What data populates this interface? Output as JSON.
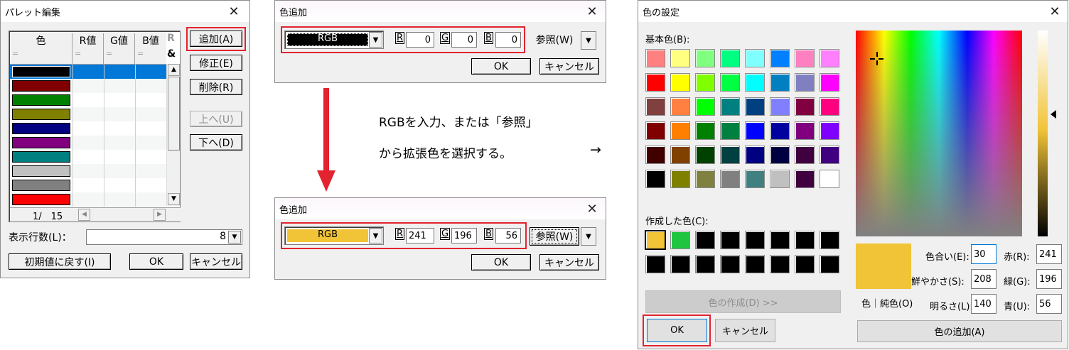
{
  "palette_edit": {
    "title": "パレット編集",
    "columns": [
      "色",
      "R値",
      "G値",
      "B値",
      "R",
      "&"
    ],
    "col_sub": "=",
    "swatches": [
      "#000000",
      "#800000",
      "#008000",
      "#808000",
      "#000080",
      "#800080",
      "#008080",
      "#c0c0c0",
      "#808080",
      "#ff0000"
    ],
    "counter": "1/　15",
    "buttons": {
      "add": "追加(A)",
      "modify": "修正(E)",
      "delete": "削除(R)",
      "up": "上へ(U)",
      "down": "下へ(D)"
    },
    "rows_label": "表示行数(L)：",
    "rows_value": "8",
    "reset": "初期値に戻す(I)",
    "ok": "OK",
    "cancel": "キャンセル"
  },
  "color_add_top": {
    "title": "色追加",
    "mode": "RGB",
    "swatch_color": "#000000",
    "r_label": "R",
    "r_value": "0",
    "g_label": "G",
    "g_value": "0",
    "b_label": "B",
    "b_value": "0",
    "ref": "参照(W)",
    "ok": "OK",
    "cancel": "キャンセル"
  },
  "color_add_bottom": {
    "title": "色追加",
    "mode": "RGB",
    "swatch_color": "#f1c438",
    "r_label": "R",
    "r_value": "241",
    "g_label": "G",
    "g_value": "196",
    "b_label": "B",
    "b_value": "56",
    "ref": "参照(W)",
    "ok": "OK",
    "cancel": "キャンセル"
  },
  "instruction": {
    "line1": "RGBを入力、または「参照」",
    "line2": "から拡張色を選択する。",
    "arrow": "→"
  },
  "color_settings": {
    "title": "色の設定",
    "basic_label": "基本色(B):",
    "basic_colors": [
      "#ff8080",
      "#ffff80",
      "#80ff80",
      "#00ff80",
      "#80ffff",
      "#0080ff",
      "#ff80c0",
      "#ff80ff",
      "#ff0000",
      "#ffff00",
      "#80ff00",
      "#00ff40",
      "#00ffff",
      "#0080c0",
      "#8080c0",
      "#ff00ff",
      "#804040",
      "#ff8040",
      "#00ff00",
      "#008080",
      "#004080",
      "#8080ff",
      "#800040",
      "#ff0080",
      "#800000",
      "#ff8000",
      "#008000",
      "#008040",
      "#0000ff",
      "#0000a0",
      "#800080",
      "#8000ff",
      "#400000",
      "#804000",
      "#004000",
      "#004040",
      "#000080",
      "#000040",
      "#400040",
      "#400080",
      "#000000",
      "#808000",
      "#808040",
      "#808080",
      "#408080",
      "#c0c0c0",
      "#400040",
      "#ffffff"
    ],
    "custom_label": "作成した色(C):",
    "custom_colors": [
      "#f1c438",
      "#1fc43f",
      "#000000",
      "#000000",
      "#000000",
      "#000000",
      "#000000",
      "#000000",
      "#000000",
      "#000000",
      "#000000",
      "#000000",
      "#000000",
      "#000000",
      "#000000",
      "#000000"
    ],
    "define_button": "色の作成(D) >>",
    "ok": "OK",
    "cancel": "キャンセル",
    "preview_color": "#f1c438",
    "preview_label": "色｜純色(O)",
    "hue_label": "色合い(E):",
    "hue_value": "30",
    "sat_label": "鮮やかさ(S):",
    "sat_value": "208",
    "lum_label": "明るさ(L):",
    "lum_value": "140",
    "red_label": "赤(R):",
    "red_value": "241",
    "green_label": "緑(G):",
    "green_value": "196",
    "blue_label": "青(U):",
    "blue_value": "56",
    "add_button": "色の追加(A)"
  },
  "colors": {
    "accent_red": "#e3232f",
    "selection_blue": "#0078d7"
  }
}
